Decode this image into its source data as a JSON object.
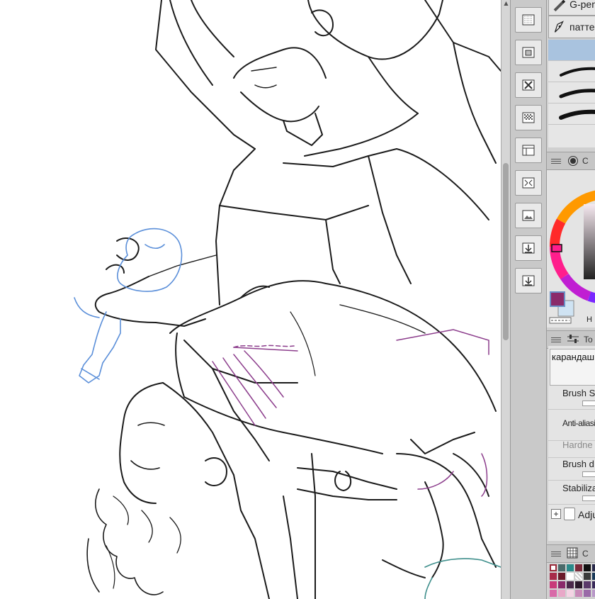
{
  "app": {
    "canvas_description_free": ""
  },
  "sub_tools": [
    {
      "label": "G-pen",
      "icon": "g-pen-icon"
    },
    {
      "label": "паттерн",
      "icon": "pen-nib-icon"
    }
  ],
  "color_panel": {
    "title": "Color Wheel",
    "title_visible": "C",
    "h_label": "H"
  },
  "tool_property": {
    "title_visible": "To",
    "tool_name": "карандаш"
  },
  "props": [
    {
      "label": "Brush Size",
      "visible": "Brush S"
    },
    {
      "label": "Anti-aliasing",
      "visible": "Anti-aliasin"
    },
    {
      "label": "Hardness",
      "visible": "Hardne"
    },
    {
      "label": "Brush density",
      "visible": "Brush d"
    },
    {
      "label": "Stabilization",
      "visible": "Stabiliza"
    }
  ],
  "adjust": {
    "visible": "Adju"
  },
  "color_set": {
    "title_visible": "C"
  },
  "colors": {
    "main_color": "#8a2a6a",
    "sub_color": "#cfe3f3",
    "selected_stroke": "#a9c3df",
    "line_blue": "#5b8fd9",
    "line_purple": "#8c3d8c",
    "line_teal": "#3f8f8c"
  },
  "command_icons": [
    "grid-layer-icon",
    "layer-mask-icon",
    "delete-layer-icon",
    "transparency-icon",
    "layer-settings-icon",
    "transform-icon",
    "image-layer-icon",
    "merge-down-icon",
    "import-icon"
  ]
}
